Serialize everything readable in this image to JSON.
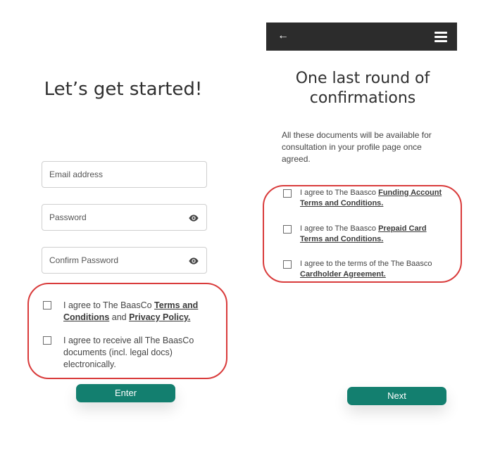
{
  "left": {
    "title": "Let’s get started!",
    "email_placeholder": "Email address",
    "password_placeholder": "Password",
    "confirm_password_placeholder": "Confirm Password",
    "agree1": {
      "prefix": "I agree to The BaasCo ",
      "link1": "Terms and Conditions",
      "mid": " and ",
      "link2": "Privacy Policy."
    },
    "agree2": "I agree to receive all The BaasCo documents (incl. legal docs) electronically.",
    "enter_label": "Enter"
  },
  "right": {
    "back_icon": "arrow-left-icon",
    "menu_icon": "hamburger-menu-icon",
    "title": "One last round of confirmations",
    "intro": "All these documents will be available for consultation in your profile page once agreed.",
    "c1": {
      "prefix": "I agree to The Baasco ",
      "link": "Funding Account Terms and Conditions."
    },
    "c2": {
      "prefix": "I agree to The Baasco ",
      "link": "Prepaid Card Terms and Conditions."
    },
    "c3": {
      "prefix": "I agree to the terms of the The Baasco ",
      "link": "Cardholder Agreement."
    },
    "next_label": "Next"
  },
  "colors": {
    "accent": "#137f6f",
    "highlight": "#d93b3b",
    "topbar": "#2c2c2c"
  }
}
